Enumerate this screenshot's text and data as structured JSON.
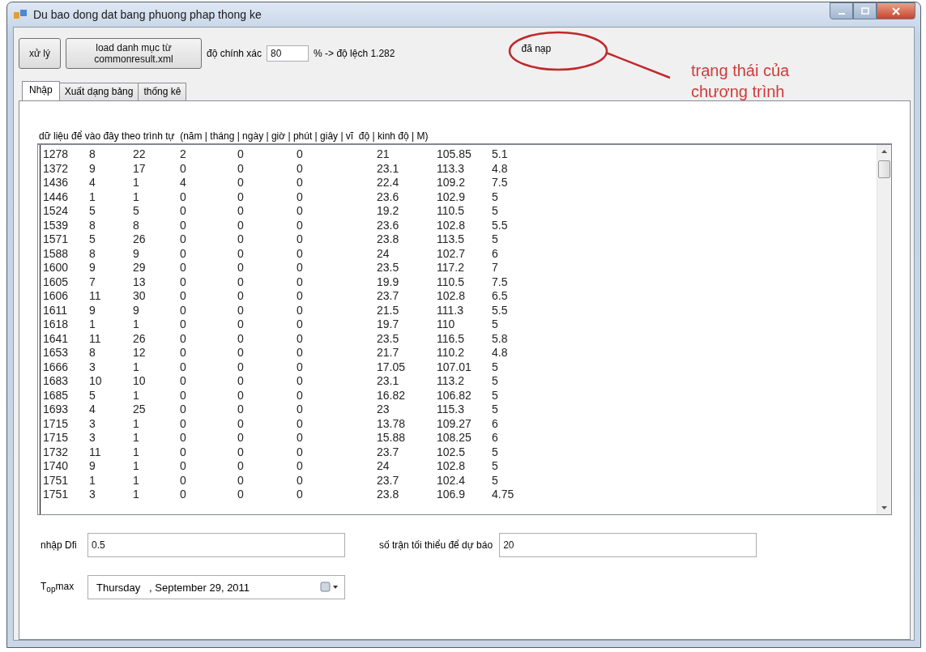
{
  "window": {
    "title": "Du bao dong dat bang phuong phap thong ke"
  },
  "toolbar": {
    "buttons": [
      "xử lý",
      "load danh mục từ commonresult.xml"
    ],
    "accuracy_label": "độ chính xác",
    "accuracy_value": "80",
    "deviation_label": "% -> độ lệch 1.282",
    "status": "đã nạp"
  },
  "annotation": {
    "text": "trạng thái của chương trình"
  },
  "tabs": [
    {
      "label": "Nhập",
      "selected": true
    },
    {
      "label": "Xuất dạng bảng",
      "selected": false
    },
    {
      "label": "thống kê",
      "selected": false
    }
  ],
  "data_input": {
    "label": "dữ liệu để vào đây theo trình tự  (năm | tháng | ngày | giờ | phút | giây | vĩ  độ | kinh độ | M)",
    "rows": [
      [
        "1278",
        "8",
        "22",
        "2",
        "0",
        "0",
        "21",
        "105.85",
        "5.1"
      ],
      [
        "1372",
        "9",
        "17",
        "0",
        "0",
        "0",
        "23.1",
        "113.3",
        "4.8"
      ],
      [
        "1436",
        "4",
        "1",
        "4",
        "0",
        "0",
        "22.4",
        "109.2",
        "7.5"
      ],
      [
        "1446",
        "1",
        "1",
        "0",
        "0",
        "0",
        "23.6",
        "102.9",
        "5"
      ],
      [
        "1524",
        "5",
        "5",
        "0",
        "0",
        "0",
        "19.2",
        "110.5",
        "5"
      ],
      [
        "1539",
        "8",
        "8",
        "0",
        "0",
        "0",
        "23.6",
        "102.8",
        "5.5"
      ],
      [
        "1571",
        "5",
        "26",
        "0",
        "0",
        "0",
        "23.8",
        "113.5",
        "5"
      ],
      [
        "1588",
        "8",
        "9",
        "0",
        "0",
        "0",
        "24",
        "102.7",
        "6"
      ],
      [
        "1600",
        "9",
        "29",
        "0",
        "0",
        "0",
        "23.5",
        "117.2",
        "7"
      ],
      [
        "1605",
        "7",
        "13",
        "0",
        "0",
        "0",
        "19.9",
        "110.5",
        "7.5"
      ],
      [
        "1606",
        "11",
        "30",
        "0",
        "0",
        "0",
        "23.7",
        "102.8",
        "6.5"
      ],
      [
        "1611",
        "9",
        "9",
        "0",
        "0",
        "0",
        "21.5",
        "111.3",
        "5.5"
      ],
      [
        "1618",
        "1",
        "1",
        "0",
        "0",
        "0",
        "19.7",
        "110",
        "5"
      ],
      [
        "1641",
        "11",
        "26",
        "0",
        "0",
        "0",
        "23.5",
        "116.5",
        "5.8"
      ],
      [
        "1653",
        "8",
        "12",
        "0",
        "0",
        "0",
        "21.7",
        "110.2",
        "4.8"
      ],
      [
        "1666",
        "3",
        "1",
        "0",
        "0",
        "0",
        "17.05",
        "107.01",
        "5"
      ],
      [
        "1683",
        "10",
        "10",
        "0",
        "0",
        "0",
        "23.1",
        "113.2",
        "5"
      ],
      [
        "1685",
        "5",
        "1",
        "0",
        "0",
        "0",
        "16.82",
        "106.82",
        "5"
      ],
      [
        "1693",
        "4",
        "25",
        "0",
        "0",
        "0",
        "23",
        "115.3",
        "5"
      ],
      [
        "1715",
        "3",
        "1",
        "0",
        "0",
        "0",
        "13.78",
        "109.27",
        "6"
      ],
      [
        "1715",
        "3",
        "1",
        "0",
        "0",
        "0",
        "15.88",
        "108.25",
        "6"
      ],
      [
        "1732",
        "11",
        "1",
        "0",
        "0",
        "0",
        "23.7",
        "102.5",
        "5"
      ],
      [
        "1740",
        "9",
        "1",
        "0",
        "0",
        "0",
        "24",
        "102.8",
        "5"
      ],
      [
        "1751",
        "1",
        "1",
        "0",
        "0",
        "0",
        "23.7",
        "102.4",
        "5"
      ],
      [
        "1751",
        "3",
        "1",
        "0",
        "0",
        "0",
        "23.8",
        "106.9",
        "4.75"
      ]
    ]
  },
  "fields": {
    "dfi_label": "nhập Dfi",
    "dfi_value": "0.5",
    "min_events_label": "số trận tối thiểu để dự báo",
    "min_events_value": "20",
    "top_max_label": "T$_{op}$max",
    "date_value": "Thursday   , September 29, 2011"
  }
}
